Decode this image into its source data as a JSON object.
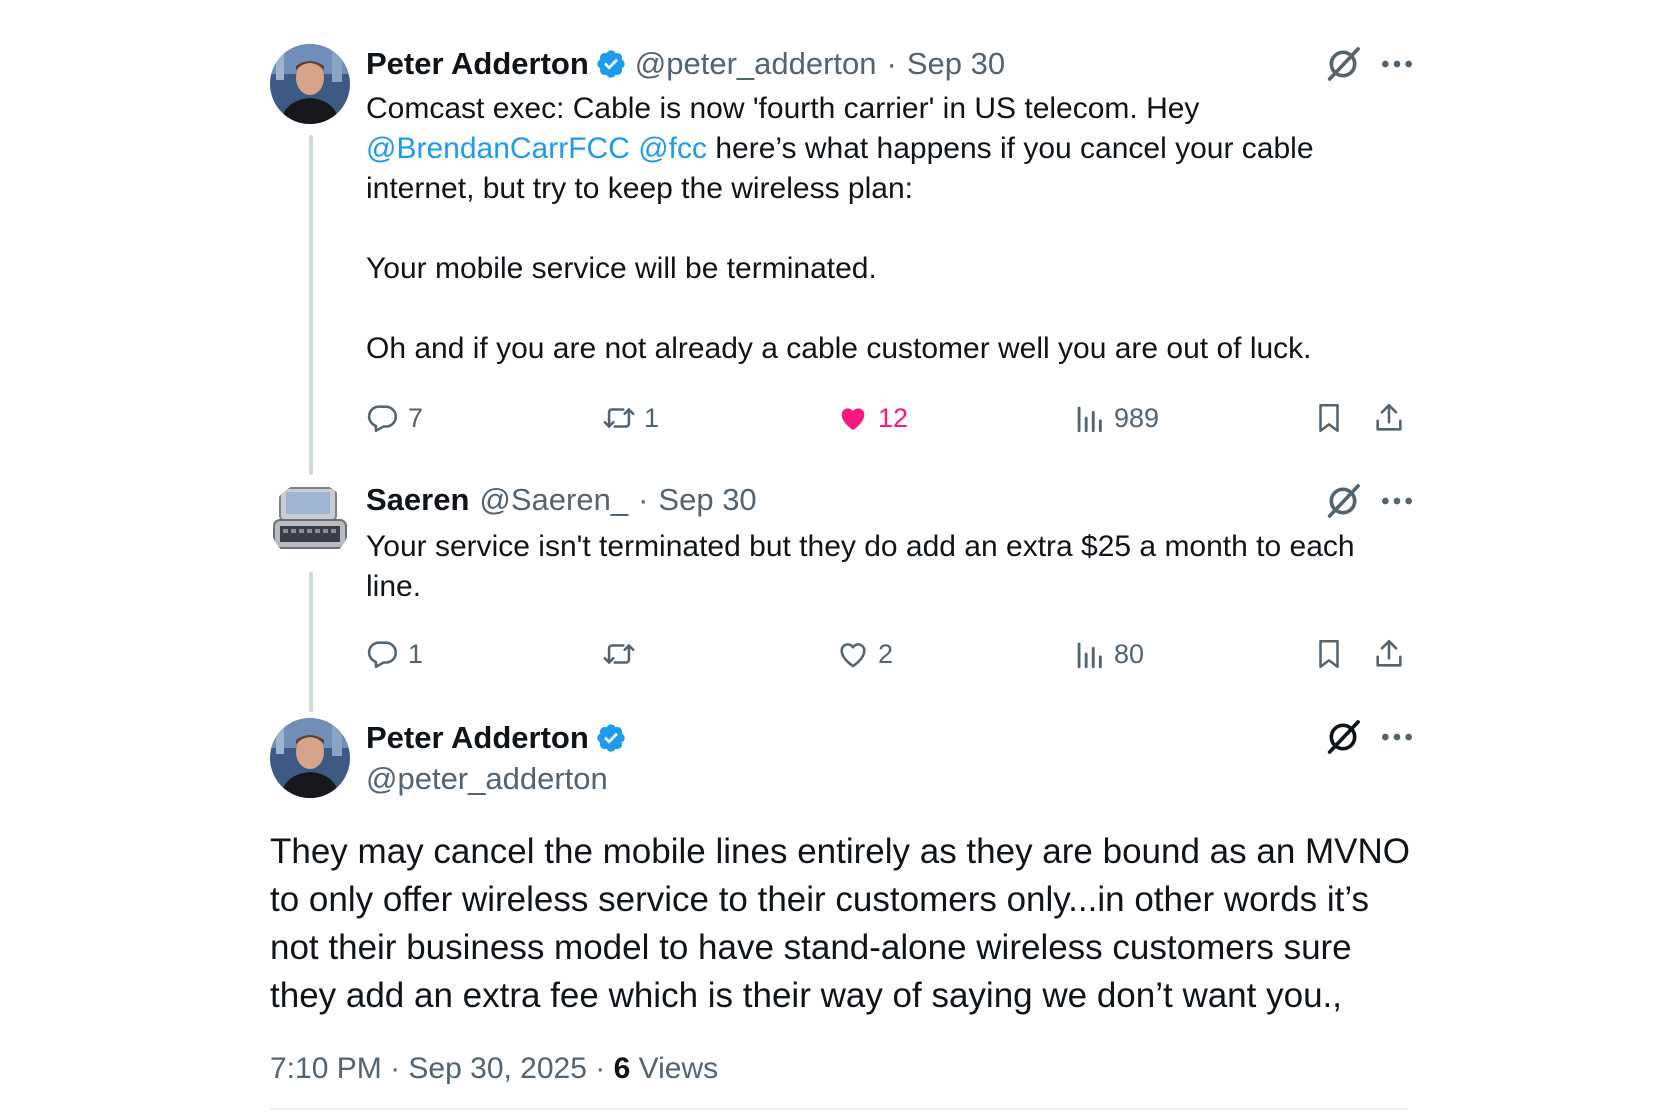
{
  "thread": {
    "tweets": [
      {
        "author": "Peter Adderton",
        "handle": "@peter_adderton",
        "separator": "·",
        "date": "Sep 30",
        "verified": true,
        "text_lines": [
          "Comcast exec: Cable is now 'fourth carrier' in US telecom. Hey",
          "internet, but try to keep the wireless plan:",
          "Your mobile service will be terminated.",
          "Oh and if you are not already a cable customer well you are out of luck."
        ],
        "mentions": [
          "@BrendanCarrFCC",
          "@fcc"
        ],
        "after_mentions": " here’s what happens if you cancel your cable",
        "replies": "7",
        "reposts": "1",
        "likes": "12",
        "liked": true,
        "views": "989"
      },
      {
        "author": "Saeren",
        "handle": "@Saeren_",
        "separator": "·",
        "date": "Sep 30",
        "verified": false,
        "text_lines": [
          "Your service isn't terminated but they do add an extra $25 a month to each",
          "line."
        ],
        "replies": "1",
        "reposts": "",
        "likes": "2",
        "liked": false,
        "views": "80"
      }
    ],
    "main_tweet": {
      "author": "Peter Adderton",
      "handle": "@peter_adderton",
      "verified": true,
      "text_lines": [
        "They may cancel the mobile lines entirely as they are bound as an MVNO",
        "to only offer wireless service to their customers only...in other words it’s",
        "not their business model to have stand-alone wireless customers sure",
        "they add an extra fee which is their way of saying we don’t want you.,"
      ],
      "time": "7:10 PM",
      "date": "Sep 30, 2025",
      "separator": "·",
      "views_count": "6",
      "views_label": "Views"
    }
  },
  "icons": {
    "verified": "verified-badge-icon",
    "grok": "grok-icon",
    "more": "more-icon",
    "reply": "reply-icon",
    "repost": "repost-icon",
    "like": "heart-icon",
    "views": "views-icon",
    "bookmark": "bookmark-icon",
    "share": "share-icon"
  },
  "colors": {
    "link": "#1d9bf0",
    "like": "#f91880",
    "secondary_text": "#536471",
    "thread_line": "#cfd9de"
  }
}
